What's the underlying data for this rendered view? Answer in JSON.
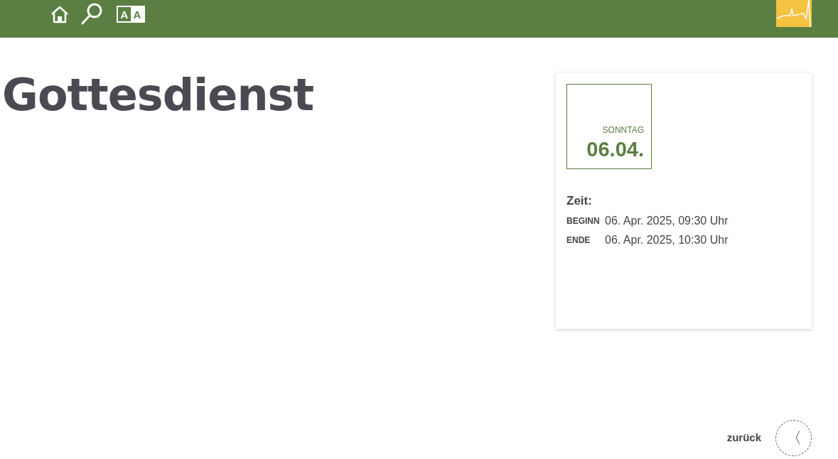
{
  "header": {
    "font_size_letters": [
      "A",
      "A"
    ]
  },
  "title": "Gottesdienst",
  "event_card": {
    "weekday": "SONNTAG",
    "date": "06.04.",
    "time_heading": "Zeit:",
    "times": [
      {
        "label": "BEGINN",
        "value": "06. Apr. 2025, 09:30 Uhr"
      },
      {
        "label": "ENDE",
        "value": "06. Apr. 2025, 10:30 Uhr"
      }
    ]
  },
  "back_link": {
    "label": "zurück",
    "arrow": "〈"
  }
}
